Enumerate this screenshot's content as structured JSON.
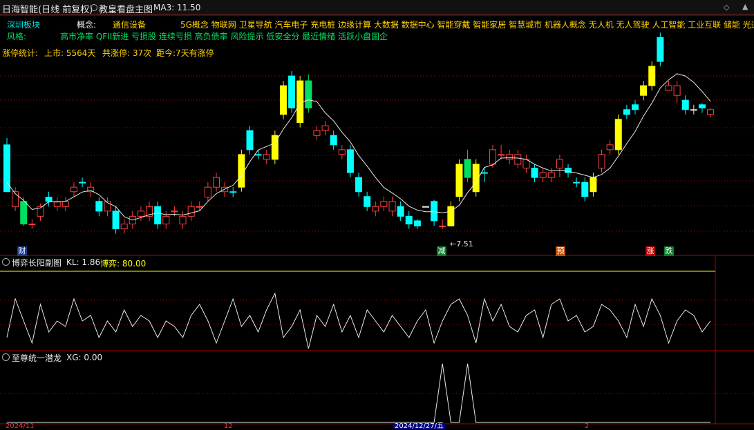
{
  "header": {
    "stock_title": "日海智能(日线 前复权)",
    "chart_name": "教皇看盘主图",
    "ma_label": "MA3: 11.50"
  },
  "info": {
    "board_label": "深圳板块",
    "concept_label": "概念:",
    "concept_sector": "通信设备",
    "concepts": "5G概念 物联网 卫星导航 汽车电子 充电桩 边缘计算 大数据 数据中心 智能穿戴 智能家居 智慧城市 机器人概念 无人机 无人驾驶 人工智能 工业互联 储能 光通",
    "style_label": "风格:",
    "styles": "高市净率 QFII新进 亏损股 连续亏损 高负债率 风险提示 低安全分 最近情绪 活跃小盘国企",
    "limit_label": "涨停统计:",
    "limit_listed": "上市: 5564天",
    "limit_total": "共涨停: 37次",
    "limit_days": "距今:7天有涨停"
  },
  "annotations": {
    "low_price": "←7.51",
    "badge_cai": "财",
    "badge_jian": "减",
    "badge_yu": "预",
    "badge_zhang": "涨",
    "badge_die": "跌"
  },
  "panel2": {
    "title": "博弈长阳副图",
    "kl": "KL: 1.86",
    "boyi": "博弈: 80.00"
  },
  "panel3": {
    "title": "至尊统一潜龙",
    "xg": "XG: 0.00"
  },
  "axis": {
    "date1": "2024/11",
    "date2": "12",
    "date_sel": "2024/12/27/五",
    "date3": "2"
  },
  "colors": {
    "up_red": "#ff4040",
    "down_cyan": "#00ffff",
    "yellow": "#ffff00",
    "green": "#00e060"
  },
  "candles": [
    [
      2.63,
      1.18,
      2.84,
      1.18,
      "cyan"
    ],
    [
      1.18,
      0.72,
      1.32,
      0.58,
      "red"
    ],
    [
      0.88,
      0.18,
      1.01,
      0.12,
      "green"
    ],
    [
      0.18,
      0.18,
      0.33,
      0.03,
      "red"
    ],
    [
      0.42,
      0.72,
      0.81,
      0.28,
      "red"
    ],
    [
      1.01,
      0.88,
      1.18,
      0.72,
      "cyan"
    ],
    [
      0.72,
      0.88,
      1.01,
      0.58,
      "red"
    ],
    [
      0.88,
      0.72,
      1.01,
      0.58,
      "red"
    ],
    [
      1.18,
      1.32,
      1.47,
      1.01,
      "red"
    ],
    [
      1.47,
      1.47,
      1.62,
      1.32,
      "cyan"
    ],
    [
      1.32,
      1.18,
      1.47,
      1.01,
      "red"
    ],
    [
      0.88,
      0.58,
      1.01,
      0.42,
      "cyan"
    ],
    [
      0.58,
      0.88,
      1.01,
      0.42,
      "red"
    ],
    [
      0.58,
      0.03,
      0.72,
      -0.12,
      "cyan"
    ],
    [
      0.18,
      0.03,
      0.33,
      -0.12,
      "red"
    ],
    [
      0.18,
      0.42,
      0.58,
      0.03,
      "red"
    ],
    [
      0.42,
      0.58,
      0.72,
      0.28,
      "red"
    ],
    [
      0.72,
      0.42,
      0.88,
      0.28,
      "red"
    ],
    [
      0.72,
      0.18,
      0.88,
      0.03,
      "cyan"
    ],
    [
      0.18,
      0.42,
      0.58,
      0.03,
      "red"
    ],
    [
      0.58,
      0.58,
      0.72,
      0.42,
      "red"
    ],
    [
      0.42,
      0.18,
      0.58,
      0.03,
      "red"
    ],
    [
      0.42,
      0.72,
      0.88,
      0.28,
      "red"
    ],
    [
      0.72,
      0.72,
      0.88,
      0.58,
      "red"
    ],
    [
      1.01,
      1.32,
      1.47,
      0.88,
      "red"
    ],
    [
      1.32,
      1.62,
      1.77,
      1.18,
      "red"
    ],
    [
      1.18,
      1.32,
      1.47,
      1.01,
      "red"
    ],
    [
      1.18,
      1.18,
      1.32,
      1.01,
      "cyan"
    ],
    [
      1.32,
      2.33,
      2.48,
      1.18,
      "yellow"
    ],
    [
      2.48,
      3.07,
      3.22,
      2.33,
      "cyan"
    ],
    [
      2.33,
      2.33,
      2.48,
      2.18,
      "cyan"
    ],
    [
      2.18,
      2.33,
      2.48,
      2.03,
      "red"
    ],
    [
      2.18,
      2.92,
      3.07,
      2.03,
      "yellow"
    ],
    [
      3.57,
      4.46,
      4.61,
      3.42,
      "yellow"
    ],
    [
      4.76,
      3.77,
      4.91,
      3.62,
      "cyan"
    ],
    [
      3.32,
      4.61,
      4.76,
      3.17,
      "yellow"
    ],
    [
      4.61,
      3.77,
      4.81,
      3.62,
      "green"
    ],
    [
      3.07,
      2.92,
      3.22,
      2.77,
      "red"
    ],
    [
      3.07,
      3.22,
      3.37,
      2.92,
      "red"
    ],
    [
      2.92,
      2.63,
      3.07,
      2.48,
      "cyan"
    ],
    [
      2.33,
      2.48,
      2.63,
      2.18,
      "red"
    ],
    [
      2.48,
      1.77,
      2.63,
      1.62,
      "cyan"
    ],
    [
      1.62,
      1.18,
      1.77,
      1.03,
      "cyan"
    ],
    [
      1.03,
      0.72,
      1.18,
      0.58,
      "cyan"
    ],
    [
      0.72,
      0.58,
      0.88,
      0.42,
      "red"
    ],
    [
      0.72,
      0.88,
      1.03,
      0.58,
      "red"
    ],
    [
      0.88,
      0.58,
      1.03,
      0.42,
      "red"
    ],
    [
      0.72,
      0.42,
      0.88,
      0.28,
      "cyan"
    ],
    [
      0.42,
      0.18,
      0.58,
      0.03,
      "cyan"
    ],
    [
      0.28,
      0.12,
      0.33,
      0.03,
      "cyan"
    ],
    [
      0.72,
      0.72,
      0.72,
      0.72,
      "white"
    ],
    [
      0.88,
      0.28,
      0.93,
      0.12,
      "cyan"
    ],
    [
      0.12,
      0.12,
      0.33,
      0.03,
      "red"
    ],
    [
      0.12,
      0.72,
      0.88,
      0.12,
      "yellow"
    ],
    [
      1.03,
      2.03,
      2.18,
      0.88,
      "yellow"
    ],
    [
      2.18,
      1.62,
      2.48,
      1.47,
      "green"
    ],
    [
      1.18,
      2.03,
      2.18,
      1.03,
      "yellow"
    ],
    [
      1.77,
      1.77,
      1.91,
      1.47,
      "cyan"
    ],
    [
      2.03,
      2.48,
      2.63,
      1.91,
      "red"
    ],
    [
      2.33,
      2.33,
      2.63,
      2.18,
      "red"
    ],
    [
      2.18,
      2.33,
      2.48,
      2.03,
      "red"
    ],
    [
      2.33,
      2.03,
      2.48,
      1.91,
      "red"
    ],
    [
      2.18,
      1.91,
      2.33,
      1.77,
      "red"
    ],
    [
      1.91,
      1.62,
      2.03,
      1.47,
      "cyan"
    ],
    [
      1.62,
      1.77,
      1.91,
      1.47,
      "red"
    ],
    [
      1.62,
      1.77,
      1.91,
      1.47,
      "red"
    ],
    [
      1.91,
      2.18,
      2.33,
      1.62,
      "red"
    ],
    [
      1.91,
      1.77,
      2.03,
      1.62,
      "cyan"
    ],
    [
      1.47,
      1.47,
      1.62,
      1.32,
      "cyan"
    ],
    [
      1.47,
      1.03,
      1.62,
      0.88,
      "cyan"
    ],
    [
      1.18,
      1.62,
      1.77,
      1.03,
      "yellow"
    ],
    [
      1.91,
      2.33,
      2.48,
      1.77,
      "red"
    ],
    [
      2.48,
      2.63,
      2.77,
      2.33,
      "red"
    ],
    [
      2.48,
      3.42,
      3.57,
      2.33,
      "yellow"
    ],
    [
      3.57,
      3.72,
      3.87,
      3.42,
      "cyan"
    ],
    [
      3.72,
      3.87,
      4.01,
      3.57,
      "cyan"
    ],
    [
      4.16,
      4.46,
      4.61,
      4.01,
      "yellow"
    ],
    [
      4.46,
      5.06,
      5.21,
      4.31,
      "yellow"
    ],
    [
      5.21,
      5.95,
      6.1,
      5.06,
      "cyan"
    ],
    [
      4.31,
      4.46,
      4.61,
      4.31,
      "red"
    ],
    [
      4.46,
      4.16,
      4.61,
      3.92,
      "red"
    ],
    [
      4.01,
      3.72,
      4.16,
      3.57,
      "cyan"
    ],
    [
      3.72,
      3.72,
      3.87,
      3.57,
      "white"
    ],
    [
      3.87,
      3.77,
      3.92,
      3.62,
      "cyan"
    ],
    [
      3.72,
      3.57,
      3.77,
      3.47,
      "red"
    ]
  ],
  "ma_line": [
    1.47,
    1.12,
    0.91,
    0.63,
    0.68,
    0.87,
    0.86,
    0.88,
    1.02,
    1.17,
    1.22,
    1.09,
    0.84,
    0.72,
    0.41,
    0.3,
    0.38,
    0.47,
    0.52,
    0.47,
    0.48,
    0.46,
    0.52,
    0.59,
    0.88,
    1.12,
    1.26,
    1.38,
    1.68,
    2.11,
    2.47,
    2.58,
    2.68,
    3.12,
    3.47,
    3.92,
    4.02,
    3.97,
    3.62,
    3.37,
    3.02,
    2.72,
    2.3,
    1.97,
    1.62,
    1.31,
    1.14,
    0.96,
    0.73,
    0.61,
    0.56,
    0.56,
    0.53,
    0.57,
    0.76,
    1.15,
    1.47,
    1.93,
    2.01,
    2.22,
    2.23,
    2.22,
    2.18,
    2.03,
    1.91,
    1.82,
    1.84,
    1.81,
    1.76,
    1.69,
    1.62,
    1.71,
    1.91,
    2.28,
    2.67,
    3.04,
    3.52,
    3.92,
    4.39,
    4.64,
    4.83,
    4.76,
    4.56,
    4.28,
    3.97
  ],
  "boyi_line": [
    0.2,
    0.9,
    0.5,
    0.1,
    0.8,
    0.3,
    0.5,
    0.4,
    0.9,
    0.5,
    0.6,
    0.2,
    0.5,
    0.3,
    0.7,
    0.4,
    0.6,
    0.5,
    0.2,
    0.5,
    0.4,
    0.2,
    0.6,
    0.8,
    0.5,
    0.1,
    0.5,
    0.9,
    0.4,
    0.6,
    0.3,
    0.7,
    1.0,
    0.2,
    0.4,
    0.7,
    0.0,
    0.6,
    0.4,
    0.8,
    0.3,
    0.6,
    0.2,
    0.7,
    0.5,
    0.3,
    0.6,
    0.4,
    0.2,
    0.5,
    0.7,
    0.1,
    0.5,
    0.8,
    0.9,
    0.6,
    0.1,
    0.9,
    0.5,
    0.8,
    0.4,
    0.3,
    0.6,
    0.7,
    0.2,
    0.8,
    0.9,
    0.5,
    0.6,
    0.3,
    0.4,
    0.8,
    0.7,
    0.5,
    0.2,
    0.8,
    0.4,
    0.9,
    0.6,
    0.1,
    0.5,
    0.7,
    0.6,
    0.3,
    0.5
  ],
  "xg_spikes": [
    0,
    0,
    0,
    0,
    0,
    0,
    0,
    0,
    0,
    0,
    0,
    0,
    0,
    0,
    0,
    0,
    0,
    0,
    0,
    0,
    0,
    0,
    0,
    0,
    0,
    0,
    0,
    0,
    0,
    0,
    0,
    0,
    0,
    0,
    0,
    0,
    0,
    0,
    0,
    0,
    0,
    0,
    0,
    0,
    0,
    0,
    0,
    0,
    0,
    0,
    0,
    0,
    1,
    0,
    0,
    1,
    0,
    0,
    0,
    0,
    0,
    0,
    0,
    0,
    0,
    0,
    0,
    0,
    0,
    0,
    0,
    0,
    0,
    0,
    0,
    0,
    0,
    0,
    0,
    0,
    0,
    0,
    0,
    0,
    0
  ]
}
